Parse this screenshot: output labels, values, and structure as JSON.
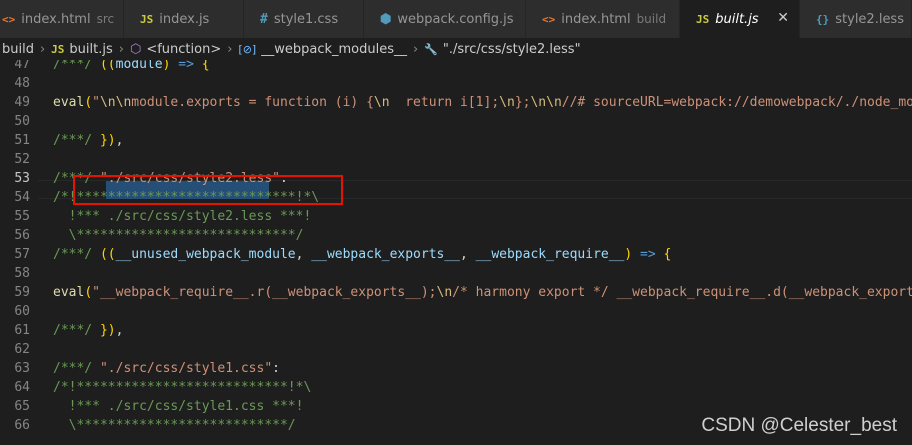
{
  "tabs": [
    {
      "icon": "<>",
      "icon_color": "#e37933",
      "label": "index.html",
      "desc": "src"
    },
    {
      "icon": "JS",
      "icon_color": "#cbcb41",
      "label": "index.js",
      "desc": ""
    },
    {
      "icon": "#",
      "icon_color": "#519aba",
      "label": "style1.css",
      "desc": ""
    },
    {
      "icon": "⬢",
      "icon_color": "#519aba",
      "label": "webpack.config.js",
      "desc": ""
    },
    {
      "icon": "<>",
      "icon_color": "#e37933",
      "label": "index.html",
      "desc": "build"
    },
    {
      "icon": "JS",
      "icon_color": "#cbcb41",
      "label": "built.js",
      "desc": "",
      "close": "✕"
    },
    {
      "icon": "{}",
      "icon_color": "#519aba",
      "label": "style2.less",
      "desc": ""
    }
  ],
  "breadcrumb": {
    "items": [
      "build",
      "built.js",
      "<function>",
      "__webpack_modules__",
      "\"./src/css/style2.less\""
    ],
    "icons": [
      "",
      "JS",
      "⬡",
      "[⊘]",
      "🔧"
    ]
  },
  "editor": {
    "lines": [
      {
        "n": "47",
        "t": [
          [
            "c",
            "/***/ "
          ],
          [
            "p",
            "(("
          ],
          [
            "v",
            "module"
          ],
          [
            "p",
            ")"
          ],
          [
            "k",
            " => "
          ],
          [
            "p",
            "{"
          ]
        ]
      },
      {
        "n": "48",
        "t": []
      },
      {
        "n": "49",
        "t": [
          [
            "f",
            "eval"
          ],
          [
            "p",
            "("
          ],
          [
            "s",
            "\""
          ],
          [
            "e",
            "\\n\\n"
          ],
          [
            "s",
            "module.exports = function (i) {"
          ],
          [
            "e",
            "\\n"
          ],
          [
            "s",
            "  return i[1];"
          ],
          [
            "e",
            "\\n"
          ],
          [
            "s",
            "};"
          ],
          [
            "e",
            "\\n\\n"
          ],
          [
            "s",
            "//# sourceURL=webpack://demowebpack/./node_modu"
          ]
        ]
      },
      {
        "n": "50",
        "t": []
      },
      {
        "n": "51",
        "t": [
          [
            "c",
            "/***/ "
          ],
          [
            "p",
            "})"
          ],
          [
            "d",
            ","
          ]
        ]
      },
      {
        "n": "52",
        "t": []
      },
      {
        "n": "53",
        "t": [
          [
            "c",
            "/***/ "
          ],
          [
            "s",
            "\"./src/css/style2.less\""
          ],
          [
            "d",
            ":"
          ]
        ]
      },
      {
        "n": "54",
        "t": [
          [
            "c",
            "/*!****************************!*\\"
          ]
        ]
      },
      {
        "n": "55",
        "t": [
          [
            "c",
            "  !*** ./src/css/style2.less ***!"
          ]
        ]
      },
      {
        "n": "56",
        "t": [
          [
            "c",
            "  \\****************************/"
          ]
        ]
      },
      {
        "n": "57",
        "t": [
          [
            "c",
            "/***/ "
          ],
          [
            "p",
            "(("
          ],
          [
            "v",
            "__unused_webpack_module"
          ],
          [
            "d",
            ", "
          ],
          [
            "v",
            "__webpack_exports__"
          ],
          [
            "d",
            ", "
          ],
          [
            "v",
            "__webpack_require__"
          ],
          [
            "p",
            ")"
          ],
          [
            "k",
            " => "
          ],
          [
            "p",
            "{"
          ]
        ]
      },
      {
        "n": "58",
        "t": []
      },
      {
        "n": "59",
        "t": [
          [
            "f",
            "eval"
          ],
          [
            "p",
            "("
          ],
          [
            "s",
            "\"__webpack_require__.r(__webpack_exports__);"
          ],
          [
            "e",
            "\\n"
          ],
          [
            "s",
            "/* harmony export */ __webpack_require__.d(__webpack_exports_"
          ]
        ]
      },
      {
        "n": "60",
        "t": []
      },
      {
        "n": "61",
        "t": [
          [
            "c",
            "/***/ "
          ],
          [
            "p",
            "})"
          ],
          [
            "d",
            ","
          ]
        ]
      },
      {
        "n": "62",
        "t": []
      },
      {
        "n": "63",
        "t": [
          [
            "c",
            "/***/ "
          ],
          [
            "s",
            "\"./src/css/style1.css\""
          ],
          [
            "d",
            ":"
          ]
        ]
      },
      {
        "n": "64",
        "t": [
          [
            "c",
            "/*!***************************!*\\"
          ]
        ]
      },
      {
        "n": "65",
        "t": [
          [
            "c",
            "  !*** ./src/css/style1.css ***!"
          ]
        ]
      },
      {
        "n": "66",
        "t": [
          [
            "c",
            "  \\***************************/"
          ]
        ]
      }
    ]
  },
  "watermark": "CSDN @Celester_best"
}
